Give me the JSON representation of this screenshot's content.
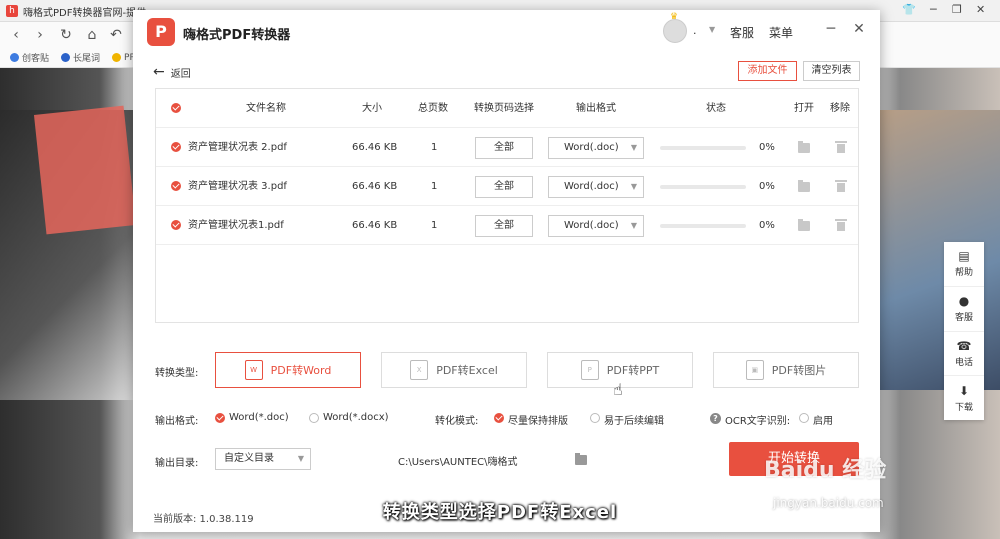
{
  "browser": {
    "tab_title": "嗨格式PDF转换器官网-提供",
    "bookmarks": [
      "创客贴",
      "长尾词",
      "PP"
    ]
  },
  "app": {
    "title": "嗨格式PDF转换器",
    "user_name": ".",
    "support_label": "客服",
    "menu_label": "菜单",
    "back_label": "返回",
    "add_file_label": "添加文件",
    "clear_list_label": "清空列表"
  },
  "table": {
    "headers": [
      "文件名称",
      "大小",
      "总页数",
      "转换页码选择",
      "输出格式",
      "状态",
      "打开",
      "移除"
    ],
    "rows": [
      {
        "name": "资产管理状况表 2.pdf",
        "size": "66.46 KB",
        "pages": "1",
        "page_select": "全部",
        "format": "Word(.doc)",
        "progress": 0,
        "status": "0%"
      },
      {
        "name": "资产管理状况表 3.pdf",
        "size": "66.46 KB",
        "pages": "1",
        "page_select": "全部",
        "format": "Word(.doc)",
        "progress": 0,
        "status": "0%"
      },
      {
        "name": "资产管理状况表1.pdf",
        "size": "66.46 KB",
        "pages": "1",
        "page_select": "全部",
        "format": "Word(.doc)",
        "progress": 0,
        "status": "0%"
      }
    ]
  },
  "conversion": {
    "type_label": "转换类型:",
    "types": [
      {
        "label": "PDF转Word",
        "active": true
      },
      {
        "label": "PDF转Excel",
        "active": false
      },
      {
        "label": "PDF转PPT",
        "active": false
      },
      {
        "label": "PDF转图片",
        "active": false
      }
    ],
    "output_format_label": "输出格式:",
    "output_formats": [
      {
        "label": "Word(*.doc)",
        "selected": true
      },
      {
        "label": "Word(*.docx)",
        "selected": false
      }
    ],
    "mode_label": "转化模式:",
    "modes": [
      {
        "label": "尽量保持排版",
        "selected": true
      },
      {
        "label": "易于后续编辑",
        "selected": false
      }
    ],
    "ocr_label": "OCR文字识别:",
    "ocr_option": "启用",
    "output_dir_label": "输出目录:",
    "output_dir_select": "自定义目录",
    "output_dir_path": "C:\\Users\\AUNTEC\\嗨格式",
    "start_label": "开始转换",
    "version_label": "当前版本: 1.0.38.119"
  },
  "side_panel": [
    "帮助",
    "客服",
    "电话",
    "下载"
  ],
  "overlay": {
    "subtitle": "转换类型选择PDF转Excel",
    "watermark": "Baidu 经验",
    "watermark_url": "jingyan.baidu.com"
  },
  "colors": {
    "accent": "#e8503f"
  }
}
